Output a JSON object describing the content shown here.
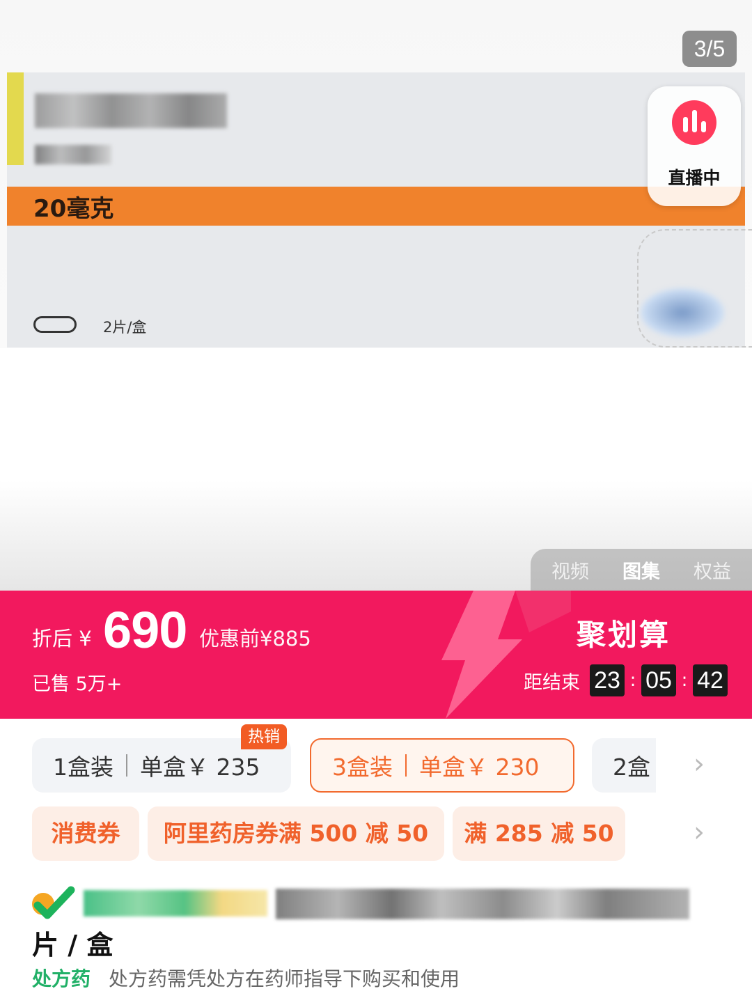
{
  "gallery": {
    "counter": "3/5",
    "image": {
      "dose": "20毫克",
      "pack_count": "2片/盒"
    },
    "live_badge": {
      "label": "直播中",
      "icon": "live-bars-icon"
    },
    "media_tabs": [
      {
        "label": "视频",
        "active": false
      },
      {
        "label": "图集",
        "active": true
      },
      {
        "label": "权益",
        "active": false
      }
    ]
  },
  "promo": {
    "after_discount_label": "折后",
    "currency": "¥",
    "price": "690",
    "original_price": "优惠前¥885",
    "sold": "已售 5万+",
    "campaign": "聚划算",
    "countdown_label": "距结束",
    "countdown": {
      "hours": "23",
      "minutes": "05",
      "seconds": "42",
      "separator": ":"
    },
    "colors": {
      "background": "#f2195e"
    }
  },
  "packages": {
    "hot_tag": "热销",
    "options": [
      {
        "qty": "1盒装",
        "unit": "单盒￥ 235",
        "selected": false
      },
      {
        "qty": "3盒装",
        "unit": "单盒￥ 230",
        "selected": true
      },
      {
        "qty": "2盒",
        "unit": "",
        "selected": false
      }
    ]
  },
  "coupons": [
    "消费券",
    "阿里药房券满 500 减 50",
    "满 285 减 50"
  ],
  "product": {
    "title_tail": "片 / 盒",
    "rx_tag": "处方药",
    "rx_note": "处方药需凭处方在药师指导下购买和使用"
  },
  "accent": {
    "orange": "#f26a2e",
    "green": "#21b067"
  }
}
